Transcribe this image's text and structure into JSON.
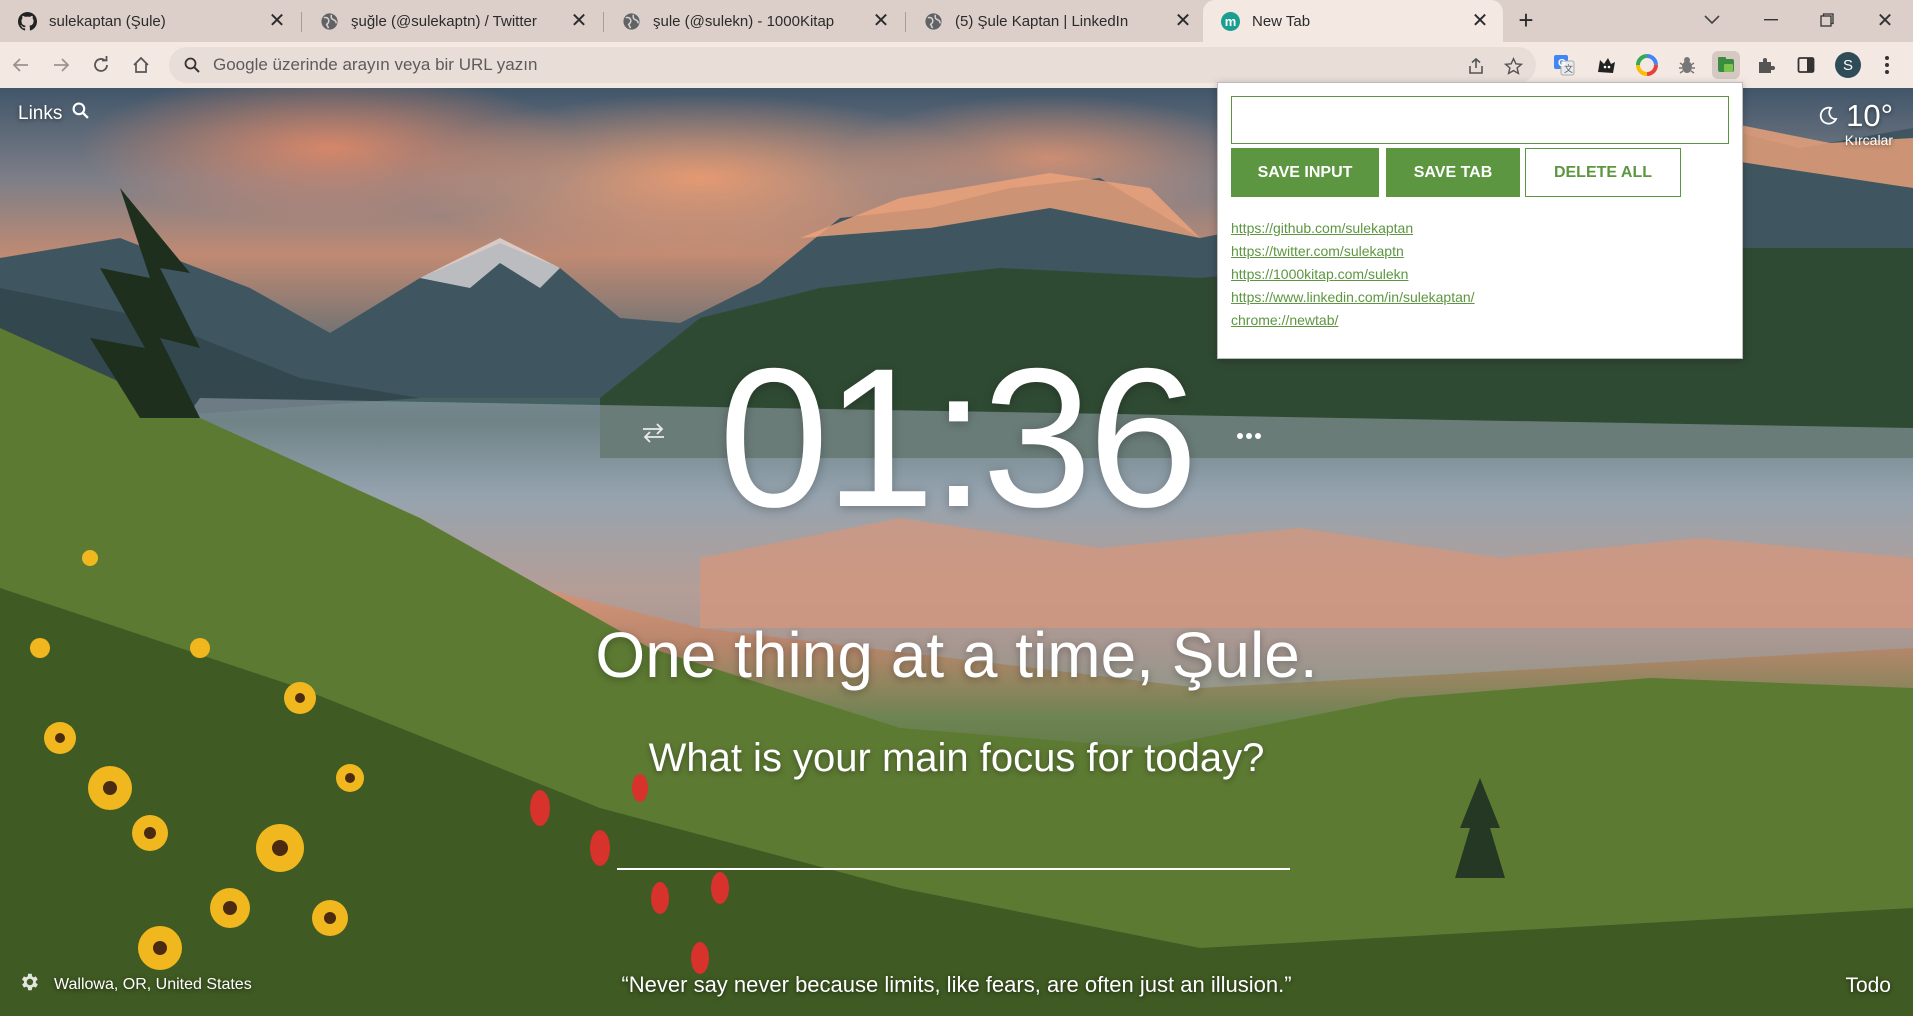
{
  "tabs": [
    {
      "title": "sulekaptan (Şule)",
      "favicon": "github-icon"
    },
    {
      "title": "şuğle (@sulekaptn) / Twitter",
      "favicon": "globe-icon"
    },
    {
      "title": "şule (@sulekn) - 1000Kitap",
      "favicon": "globe-icon"
    },
    {
      "title": "(5) Şule Kaptan | LinkedIn",
      "favicon": "globe-icon"
    },
    {
      "title": "New Tab",
      "favicon": "momentum-icon",
      "favicon_letter": "m",
      "active": true
    }
  ],
  "toolbar": {
    "omnibox_placeholder": "Google üzerinde arayın veya bir URL yazın",
    "profile_initial": "S"
  },
  "page": {
    "links_label": "Links",
    "weather": {
      "temperature": "10°",
      "location": "Kırcalar"
    },
    "clock": "01:36",
    "greeting": "One thing at a time, Şule.",
    "focus_question": "What is your main focus for today?",
    "location": "Wallowa, OR, United States",
    "quote": "“Never say never because limits, like fears, are often just an illusion.”",
    "todo_label": "Todo"
  },
  "popup": {
    "save_input_label": "SAVE INPUT",
    "save_tab_label": "SAVE TAB",
    "delete_all_label": "DELETE ALL",
    "saved_links": [
      "https://github.com/sulekaptan",
      "https://twitter.com/sulekaptn",
      "https://1000kitap.com/sulekn",
      "https://www.linkedin.com/in/sulekaptan/",
      "chrome://newtab/"
    ]
  },
  "colors": {
    "tabstrip": "#dccfc9",
    "toolbar": "#f4e8e3",
    "popup_accent": "#5d9640",
    "momentum_favicon": "#1a9e8f"
  }
}
